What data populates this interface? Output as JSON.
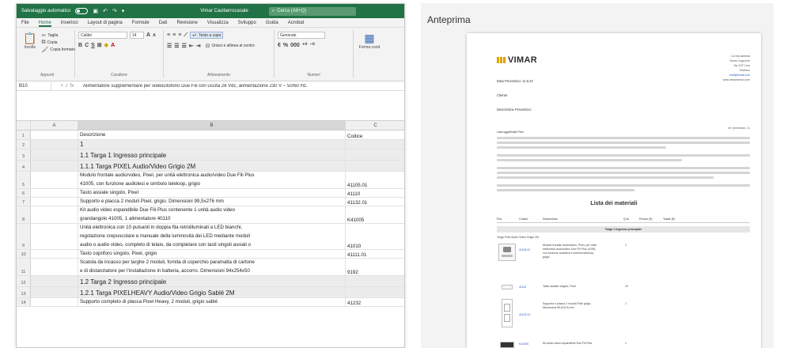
{
  "excel": {
    "autosave_label": "Salvataggio automatico",
    "doc_title": "Vimar Casiberrocasale",
    "search_placeholder": "Cerca (Alt+Q)",
    "menu": [
      "File",
      "Home",
      "Inserisci",
      "Layout di pagina",
      "Formule",
      "Dati",
      "Revisione",
      "Visualizza",
      "Sviluppo",
      "Guida",
      "Acrobat"
    ],
    "ribbon": {
      "paste": "Incolla",
      "cut": "Taglia",
      "copy": "Copia",
      "format_painter": "Copia formato",
      "clipboard_label": "Appunti",
      "font_name": "Calibri",
      "font_size": "14",
      "font_label": "Carattere",
      "wrap": "Testo a capo",
      "merge": "Unisci e allinea al centro",
      "align_label": "Allineamento",
      "number_format": "Generale",
      "number_label": "Numeri",
      "extra": "Forma cond"
    },
    "name_box": "B10",
    "formula": "Alimentatore supplementare per videocitofono Due Fili con uscita 28 Vdc, alimentazione 230 V ~ 50/60 Hz.",
    "columns": [
      "A",
      "B",
      "C"
    ],
    "rows": [
      {
        "n": "1",
        "b": [
          "Descrizione"
        ],
        "c": "Codice",
        "style": ""
      },
      {
        "n": "2",
        "b": [
          "1"
        ],
        "c": "",
        "style": "shade mid"
      },
      {
        "n": "3",
        "b": [
          "1.1 Targa 1 Ingresso principale"
        ],
        "c": "",
        "style": "shade mid"
      },
      {
        "n": "4",
        "b": [
          "1.1.1 Targa PIXEL Audio/Video Grigio 2M"
        ],
        "c": "",
        "style": "shade mid"
      },
      {
        "n": "5",
        "b": [
          "Modulo frontale audio/video, Pixel, per unità elettronica audio/video Due Fili Plus",
          "41005, con funzione audiolesi e simbolo teleloop, grigio"
        ],
        "c": "41105.01",
        "style": ""
      },
      {
        "n": "6",
        "b": [
          "Tasto assiale singolo, Pixel"
        ],
        "c": "41110",
        "style": ""
      },
      {
        "n": "7",
        "b": [
          "Supporto e placca 2 moduli Pixel, grigio. Dimensioni 99,5x276 mm"
        ],
        "c": "41132.01",
        "style": ""
      },
      {
        "n": "8",
        "b": [
          "Kit audio video espandibile Due Fili Plus contenente 1 unità audio video",
          "grandangolo 41005, 1 alimentatore 40110"
        ],
        "c": "K41005",
        "style": ""
      },
      {
        "n": "9",
        "b": [
          "Unità elettronica con 10 pulsanti in doppia fila retroilluminati a LED bianchi,",
          "regolazione crepuscolare e manuale della luminosità dei LED mediante moduli",
          "audio o audio video, completo di telaio, da completare con tasti singoli assiali o"
        ],
        "c": "41010",
        "style": ""
      },
      {
        "n": "10",
        "b": [
          "Tasto copriforo singolo, Pixel, grigio"
        ],
        "c": "41111.01",
        "style": ""
      },
      {
        "n": "11",
        "b": [
          "Scatola da incasso per targhe 2 moduli, fornita di coperchio paramalta di cartone",
          "e di distanziatore per l'installazione in batteria, accorro. Dimensioni 94x254x50"
        ],
        "c": "9192",
        "style": ""
      },
      {
        "n": "12",
        "b": [
          "1.2 Targa 2 Ingresso principale"
        ],
        "c": "",
        "style": "shade mid"
      },
      {
        "n": "13",
        "b": [
          "1.2.1 Targa PIXELHEAVY Audio/Video Grigio Sablé 2M"
        ],
        "c": "",
        "style": "shade mid"
      },
      {
        "n": "14",
        "b": [
          "Supporto completo di placca Pixel Heavy,  2 moduli, grigio sablé"
        ],
        "c": "41232",
        "style": ""
      }
    ]
  },
  "preview": {
    "title": "Anteprima",
    "logo": "VIMAR",
    "address": [
      "La mia azienda",
      "Nome Cognome",
      "Via 123° Lino",
      "Telefono",
      "mail@email.com",
      "www.vimarservizi.com"
    ],
    "date_label": "Data Preventivo: 11.8.22",
    "client_label": "Cliente:",
    "desc_label": "Descrizione Preventivo:",
    "ref_label": "ref. preventivo: 11",
    "subject": "Lista oggetti/alla Pixel",
    "list_title": "Lista dei materiali",
    "table_headers": [
      "Pos.",
      "Codice",
      "Descrizione",
      "Q.tà",
      "Prezzo (€)",
      "Totale (€)"
    ],
    "group": "Targa 1 Ingresso principale",
    "subgroup": "Targa Pixel Audio Video Grigio 2M",
    "items": [
      {
        "code": "41105.01",
        "desc": "Modulo frontale audio/video, Pixel, per unità elettronica audio/video Due Fili Plus 41005, con funzione audiolesi e simbolo teleloop, grigio",
        "qty": "1"
      },
      {
        "code": "41110",
        "desc": "Tasto assiale singolo, Pixel",
        "qty": "10"
      },
      {
        "code": "41132.01",
        "desc": "Supporto e placca 2 moduli Pixel grigio. Dimensioni 99,5x276 mm",
        "qty": "1"
      },
      {
        "code": "K41005",
        "desc": "Kit audio video espandibile Due Fili Plus",
        "qty": "1"
      }
    ]
  }
}
